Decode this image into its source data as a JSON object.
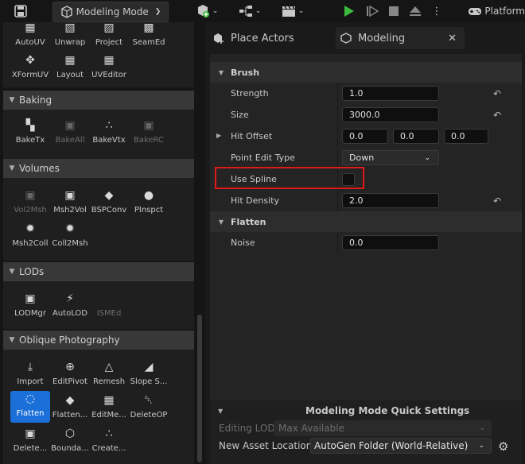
{
  "toolbar": {
    "mode_label": "Modeling Mode",
    "platform_label": "Platform"
  },
  "left": {
    "top_tools": [
      {
        "label": "AutoUV",
        "icon": "autouv-icon"
      },
      {
        "label": "Unwrap",
        "icon": "unwrap-icon"
      },
      {
        "label": "Project",
        "icon": "project-icon"
      },
      {
        "label": "SeamEd",
        "icon": "seamed-icon"
      },
      {
        "label": "XFormUV",
        "icon": "xformuv-icon"
      },
      {
        "label": "Layout",
        "icon": "layout-icon"
      },
      {
        "label": "UVEditor",
        "icon": "uveditor-icon"
      }
    ],
    "baking": {
      "title": "Baking",
      "tools": [
        {
          "label": "BakeTx",
          "icon": "baketx-icon"
        },
        {
          "label": "BakeAll",
          "icon": "bakeall-icon"
        },
        {
          "label": "BakeVtx",
          "icon": "bakevtx-icon"
        },
        {
          "label": "BakeRC",
          "icon": "bakerc-icon"
        }
      ]
    },
    "volumes": {
      "title": "Volumes",
      "tools": [
        {
          "label": "Vol2Msh",
          "icon": "vol2msh-icon"
        },
        {
          "label": "Msh2Vol",
          "icon": "msh2vol-icon"
        },
        {
          "label": "BSPConv",
          "icon": "bspconv-icon"
        },
        {
          "label": "PInspct",
          "icon": "pinspct-icon"
        },
        {
          "label": "Msh2Coll",
          "icon": "msh2coll-icon"
        },
        {
          "label": "Coll2Msh",
          "icon": "coll2msh-icon"
        }
      ]
    },
    "lods": {
      "title": "LODs",
      "tools": [
        {
          "label": "LODMgr",
          "icon": "lodmgr-icon"
        },
        {
          "label": "AutoLOD",
          "icon": "autolod-icon"
        },
        {
          "label": "ISMEd",
          "icon": "ismed-icon"
        }
      ]
    },
    "oblique": {
      "title": "Oblique Photography",
      "tools": [
        {
          "label": "Import",
          "icon": "import-icon"
        },
        {
          "label": "EditPivot",
          "icon": "editpivot-icon"
        },
        {
          "label": "Remesh",
          "icon": "remesh-icon"
        },
        {
          "label": "Slope S...",
          "icon": "slope-icon"
        },
        {
          "label": "Flatten",
          "icon": "flatten-icon"
        },
        {
          "label": "Flatten...",
          "icon": "flatten-more-icon"
        },
        {
          "label": "EditMe...",
          "icon": "editmesh-icon"
        },
        {
          "label": "DeleteOP",
          "icon": "trash-icon"
        },
        {
          "label": "Delete...",
          "icon": "delete-icon"
        },
        {
          "label": "Bounda...",
          "icon": "boundary-icon"
        },
        {
          "label": "Create...",
          "icon": "create-icon"
        }
      ]
    }
  },
  "right": {
    "tabs": [
      {
        "label": "Place Actors"
      },
      {
        "label": "Modeling"
      }
    ],
    "brush": {
      "title": "Brush",
      "strength_label": "Strength",
      "strength": "1.0",
      "size_label": "Size",
      "size": "3000.0",
      "hit_offset_label": "Hit Offset",
      "hit_offset": [
        "0.0",
        "0.0",
        "0.0"
      ],
      "point_edit_type_label": "Point Edit Type",
      "point_edit_type": "Down",
      "use_spline_label": "Use Spline",
      "hit_density_label": "Hit Density",
      "hit_density": "2.0"
    },
    "flatten": {
      "title": "Flatten",
      "noise_label": "Noise",
      "noise": "0.0"
    },
    "quick_settings": {
      "title": "Modeling Mode Quick Settings",
      "editing_lod_label": "Editing LOD",
      "editing_lod": "Max Available",
      "new_asset_location_label": "New Asset Location",
      "new_asset_location": "AutoGen Folder (World-Relative)"
    }
  },
  "colors": {
    "accent": "#1b6fd8",
    "highlight": "#e01818",
    "play_green": "#3dbb3d"
  }
}
